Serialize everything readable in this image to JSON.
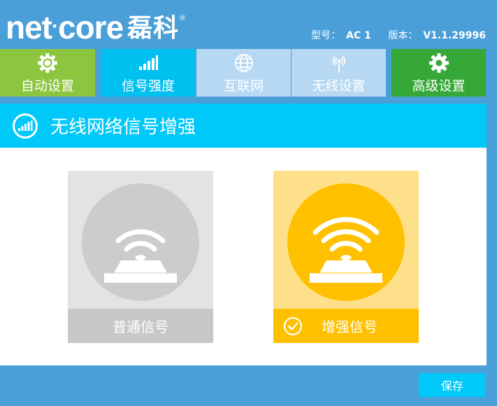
{
  "brand": {
    "name": "net·core",
    "cn": "磊科",
    "reg": "®"
  },
  "meta": {
    "model_label": "型号：",
    "model_value": "AC 1",
    "version_label": "版本：",
    "version_value": "V1.1.29996"
  },
  "tabs": [
    {
      "label": "自动设置",
      "icon": "gear-refresh-icon",
      "color": "#8cc63f"
    },
    {
      "label": "信号强度",
      "icon": "signal-bars-icon",
      "color": "#00c0f0"
    },
    {
      "label": "互联网",
      "icon": "globe-icon",
      "color": "#b6d8f2"
    },
    {
      "label": "无线设置",
      "icon": "antenna-icon",
      "color": "#b6d8f2"
    },
    {
      "label": "高级设置",
      "icon": "gear-icon",
      "color": "#36a837"
    }
  ],
  "panel": {
    "title": "无线网络信号增强",
    "icon": "signal-bars-icon"
  },
  "options": [
    {
      "label": "普通信号",
      "selected": false,
      "icon": "router-wifi-icon"
    },
    {
      "label": "增强信号",
      "selected": true,
      "icon": "router-wifi-icon"
    }
  ],
  "save_label": "保存",
  "colors": {
    "background": "#4a9fd8",
    "accent": "#00c8f8",
    "selected": "#ffc000"
  }
}
